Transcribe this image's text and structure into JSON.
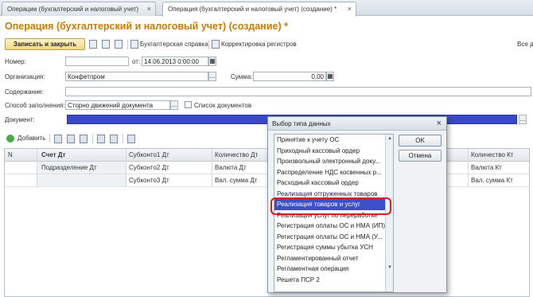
{
  "tabs": [
    {
      "label": "Операции (бухгалтерский и налоговый учет)"
    },
    {
      "label": "Операция (бухгалтерский и налоговый учет) (создание) *"
    }
  ],
  "close_glyph": "×",
  "title": "Операция (бухгалтерский и налоговый учет) (создание) *",
  "toolbar": {
    "save_close": "Записать и закрыть",
    "accounting_ref": "Бухгалтерская справка",
    "reg_correction": "Корректировка регистров",
    "all_actions": "Все д"
  },
  "form": {
    "number_label": "Номер:",
    "number_value": "",
    "from_label": "от:",
    "date_value": "14.06.2013 0:00:00",
    "org_label": "Организация:",
    "org_value": "Конфетпром",
    "sum_label": "Сумма:",
    "sum_value": "0,00",
    "content_label": "Содержание:",
    "content_value": "",
    "fill_label": "Способ заполнения:",
    "fill_value": "Сторно движений документа",
    "doclist_label": "Список документов",
    "doc_label": "Документ:",
    "dots": "...",
    "calc": "▦"
  },
  "table_toolbar": {
    "add": "Добавить"
  },
  "table": {
    "headers": [
      "N",
      "Счет Дт",
      "Субконто1 Дт",
      "Количество Дт",
      "Количество Кт"
    ],
    "rows": [
      [
        "",
        "Подразделение Дт",
        "Субконто2 Дт",
        "Валюта Дт",
        "Валюта Кт"
      ],
      [
        "",
        "",
        "Субконто3 Дт",
        "Вал. сумма Дт",
        "Вал. сумма Кт"
      ]
    ]
  },
  "dialog": {
    "title": "Выбор типа данных",
    "ok": "OK",
    "cancel": "Отмена",
    "items": [
      "Принятие к учету ОС",
      "Приходный кассовый ордер",
      "Произвольный электронный доку...",
      "Распределение НДС косвенных р...",
      "Расходный кассовый ордер",
      "Реализация отгруженных товаров",
      "Реализация товаров и услуг",
      "Реализация услуг по переработке",
      "Регистрация оплаты ОС и НМА (ИП)",
      "Регистрация оплаты ОС и НМА (У...",
      "Регистрация суммы убытка УСН",
      "Регламентированный отчет",
      "Регламентная операция",
      "Решета ПСР 2"
    ],
    "selected_index": 6
  },
  "colors": {
    "title": "#cc7a00",
    "selection": "#3a4fc8",
    "highlight_ring": "#d42020"
  }
}
